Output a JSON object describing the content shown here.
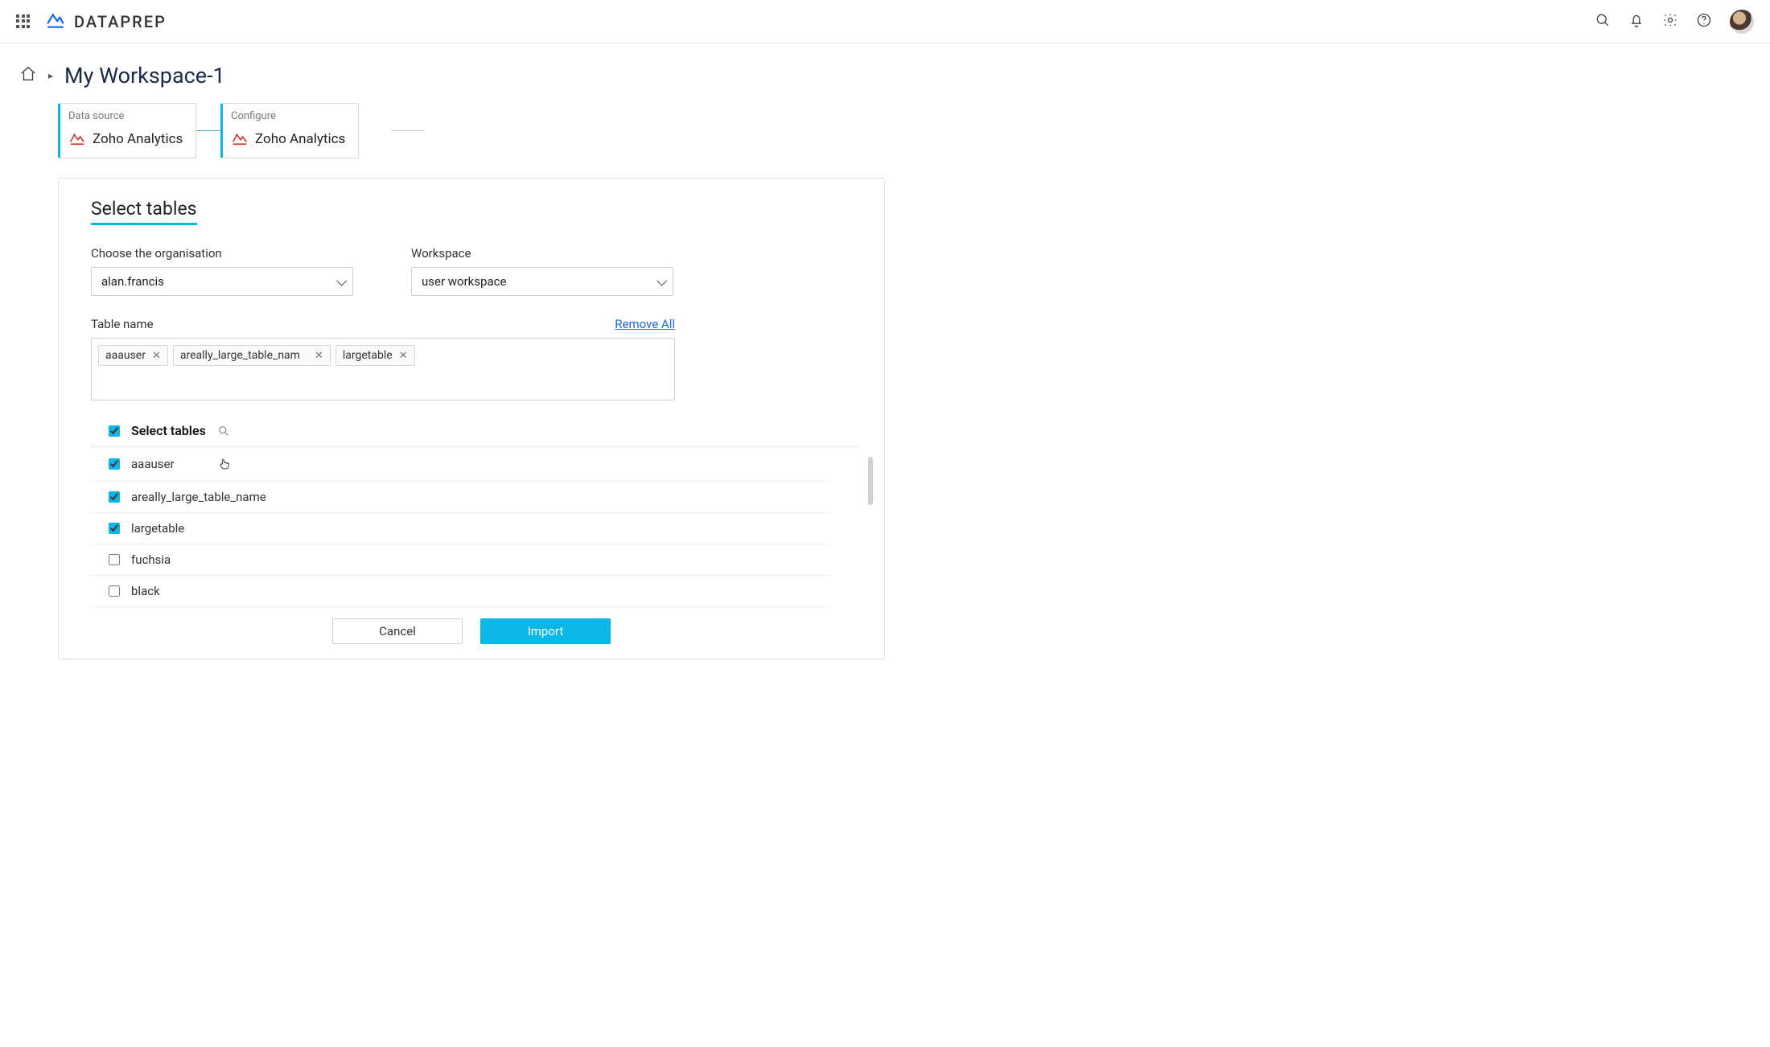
{
  "app": {
    "brand": "DATAPREP"
  },
  "breadcrumb": {
    "title": "My Workspace-1"
  },
  "steps": [
    {
      "label": "Data source",
      "name": "Zoho Analytics"
    },
    {
      "label": "Configure",
      "name": "Zoho Analytics"
    }
  ],
  "panel": {
    "title": "Select tables",
    "org_label": "Choose the organisation",
    "org_value": "alan.francis",
    "workspace_label": "Workspace",
    "workspace_value": "user workspace",
    "tablename_label": "Table name",
    "remove_all": "Remove All",
    "tags": [
      "aaauser",
      "areally_large_table_nam",
      "largetable"
    ],
    "list_title": "Select tables",
    "rows": [
      {
        "name": "aaauser",
        "checked": true
      },
      {
        "name": "areally_large_table_name",
        "checked": true
      },
      {
        "name": "largetable",
        "checked": true
      },
      {
        "name": "fuchsia",
        "checked": false
      },
      {
        "name": "black",
        "checked": false
      }
    ],
    "cancel": "Cancel",
    "import": "Import"
  }
}
